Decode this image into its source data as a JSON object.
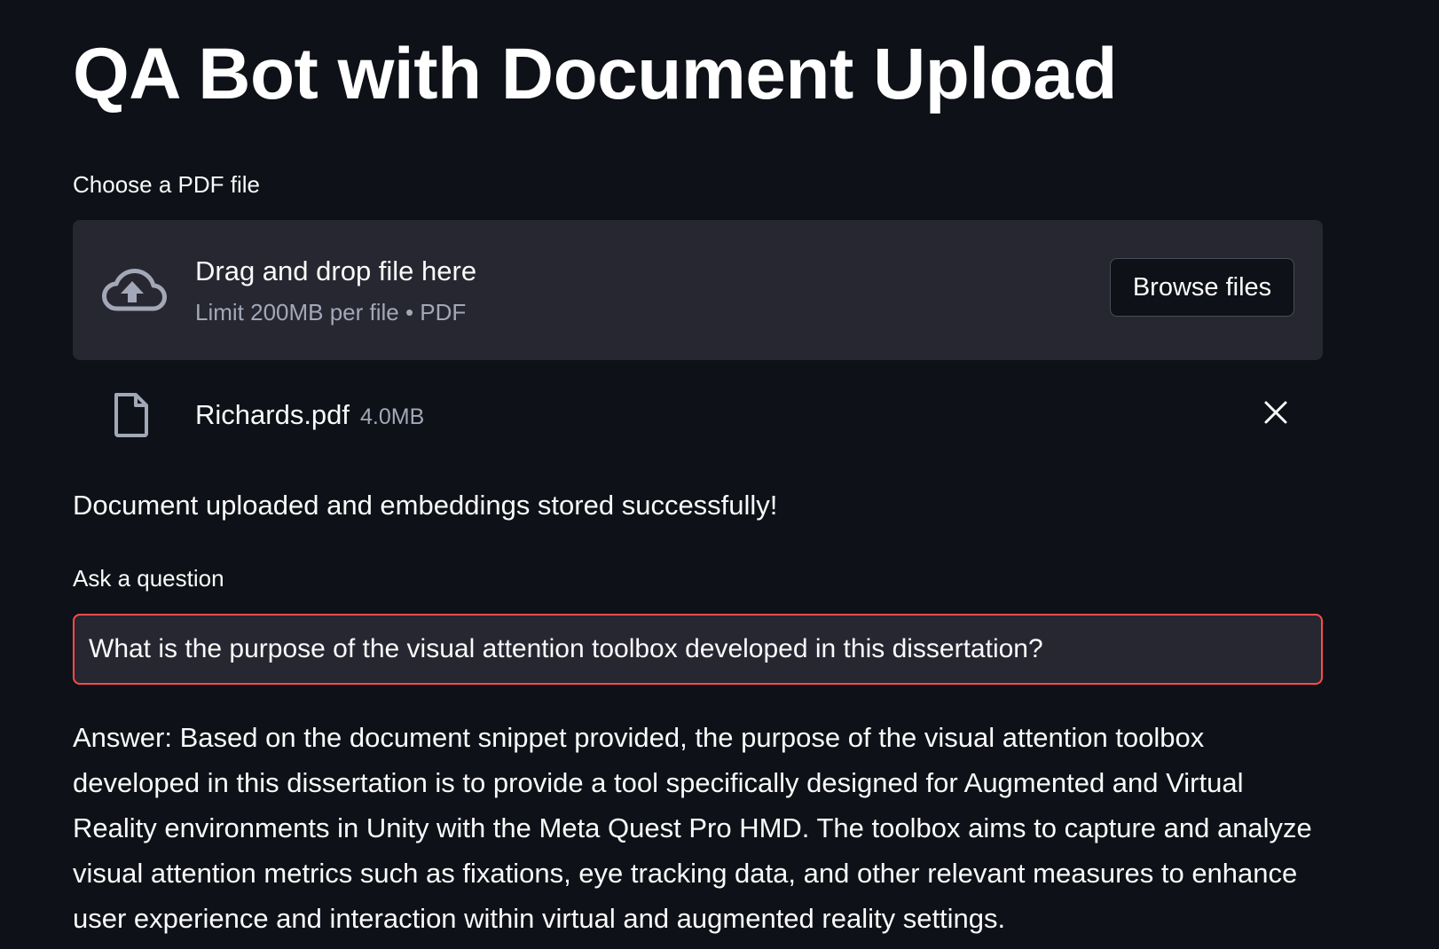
{
  "page": {
    "title": "QA Bot with Document Upload"
  },
  "uploader": {
    "label": "Choose a PDF file",
    "dropzone_title": "Drag and drop file here",
    "dropzone_limit": "Limit 200MB per file • PDF",
    "browse_label": "Browse files",
    "icon": "cloud-upload-icon"
  },
  "uploaded_file": {
    "name": "Richards.pdf",
    "size": "4.0MB",
    "icon": "file-icon",
    "remove_icon": "close-icon"
  },
  "status": {
    "message": "Document uploaded and embeddings stored successfully!"
  },
  "question": {
    "label": "Ask a question",
    "value": "What is the purpose of the visual attention toolbox developed in this dissertation?",
    "border_color": "#ff4b4b"
  },
  "answer": {
    "text": "Answer: Based on the document snippet provided, the purpose of the visual attention toolbox developed in this dissertation is to provide a tool specifically designed for Augmented and Virtual Reality environments in Unity with the Meta Quest Pro HMD. The toolbox aims to capture and analyze visual attention metrics such as fixations, eye tracking data, and other relevant measures to enhance user experience and interaction within virtual and augmented reality settings."
  },
  "theme": {
    "background": "#0e1117",
    "secondary_background": "#262730",
    "text": "#fafafa",
    "muted_text": "#a3a8b8",
    "accent": "#ff4b4b"
  }
}
